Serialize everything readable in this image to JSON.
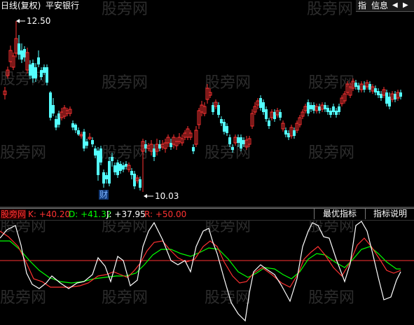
{
  "header": {
    "period_label": "日线(复权)",
    "stock_name": "平安银行",
    "btn_index": "指",
    "btn_info": "信息",
    "arrow_left": "◀",
    "arrow_right": "▶"
  },
  "watermark": "股旁网",
  "price_panel": {
    "high_label": "12.50",
    "low_label": "10.03",
    "event_marker": "财",
    "up_color": "#ff3232",
    "down_color": "#54ffff"
  },
  "indicator_panel": {
    "name": "股旁网",
    "k_label": "K: +40.20",
    "d_label": "D: +41.32",
    "j_label": "J: +37.95",
    "r_label": "R: +50.00",
    "k_color": "#ff3232",
    "d_color": "#00ff00",
    "j_color": "#ffffff",
    "r_color": "#ff3232",
    "btn_best": "最优指标",
    "btn_help": "指标说明"
  }
}
